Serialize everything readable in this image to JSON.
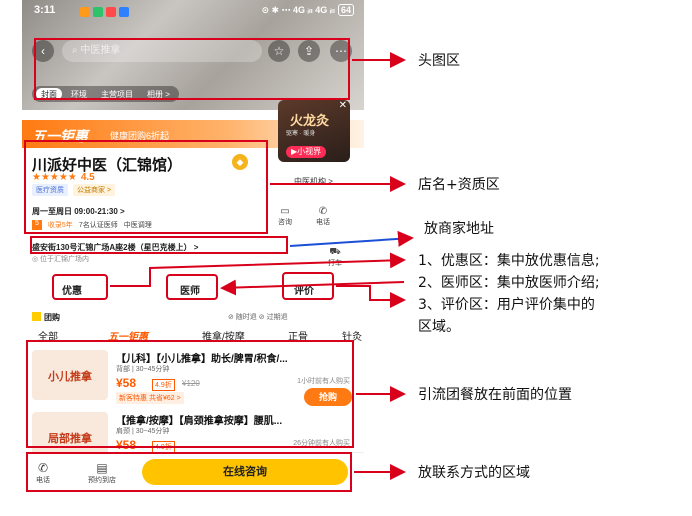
{
  "status": {
    "time": "3:11",
    "right": "⊙ ✱ ⋯ 4G ᵢₗₗ 4G ᵢₗₗ",
    "battery": "64"
  },
  "nav": {
    "back_icon": "‹",
    "search_placeholder": "中医推拿",
    "star_icon": "☆",
    "share_icon": "⇪",
    "more_icon": "⋯"
  },
  "hero_tabs": [
    "封面",
    "环境",
    "主营项目",
    "相册 >"
  ],
  "promo": {
    "big": "五一钜惠",
    "small": "健康团购6折起"
  },
  "video": {
    "title": "火龙灸",
    "subtitle": "驱寒 · 暖身",
    "badge": "▶小视界"
  },
  "shop": {
    "name": "川派好中医（汇锦馆）",
    "medal": "◆",
    "stars": "★★★★★",
    "rating": "4.5",
    "badge1": "医疗资质",
    "badge2": "公益商家 >",
    "category": "中医机构 >",
    "hours": "周一至周日 09:00-21:30 >"
  },
  "tags": [
    "5",
    "收录5年",
    "7名认证医师",
    "中医调理"
  ],
  "contacts": [
    {
      "icon": "▭",
      "label": "咨询"
    },
    {
      "icon": "✆",
      "label": "电话"
    }
  ],
  "address": {
    "main": "盛安街130号汇锦广场A座2楼（星巴克楼上） >",
    "sub": "◎ 位于汇锦广场内",
    "taxi_icon": "⛟",
    "taxi_label": "打车"
  },
  "sections": {
    "discount": "优惠",
    "doctor": "医师",
    "review": "评价"
  },
  "group": {
    "title": "团购",
    "flags": "⊘ 随时退   ⊘ 过期退"
  },
  "group_tabs": [
    "全部",
    "五一钜惠",
    "推拿/按摩",
    "正骨",
    "针灸"
  ],
  "deals": [
    {
      "img": "小儿推拿",
      "title": "【儿科】【小儿推拿】助长/脾胃/积食/...",
      "sub": "背部 | 30~45分钟",
      "price": "¥58",
      "disc": "4.9折",
      "orig": "¥120",
      "promo": "新客特惠 共省¥62 >",
      "sold": "1小时前有人购买",
      "buy": "抢购"
    },
    {
      "img": "局部推拿",
      "title": "【推拿/按摩】【肩颈推拿按摩】腰肌...",
      "sub": "肩颈 | 30~45分钟",
      "price": "¥58",
      "disc": "4.9折",
      "orig": "",
      "promo": "",
      "sold": "26分钟前有人购买",
      "buy": ""
    }
  ],
  "bottom": {
    "phone_icon": "✆",
    "phone": "电话",
    "visit_icon": "▤",
    "visit": "预约到店",
    "consult": "在线咨询"
  },
  "annotations": {
    "hero": "头图区",
    "shopname": "店名+资质区",
    "address": "放商家地址",
    "sections": [
      "1、优惠区：集中放优惠信息;",
      "2、医师区：集中放医师介绍;",
      "3、评价区：用户评价集中的",
      "区域。"
    ],
    "deals": "引流团餐放在前面的位置",
    "contact": "放联系方式的区域"
  },
  "colors": {
    "annotation": "#d9001b",
    "accent": "#ff7a12",
    "consult": "#ffc300"
  }
}
